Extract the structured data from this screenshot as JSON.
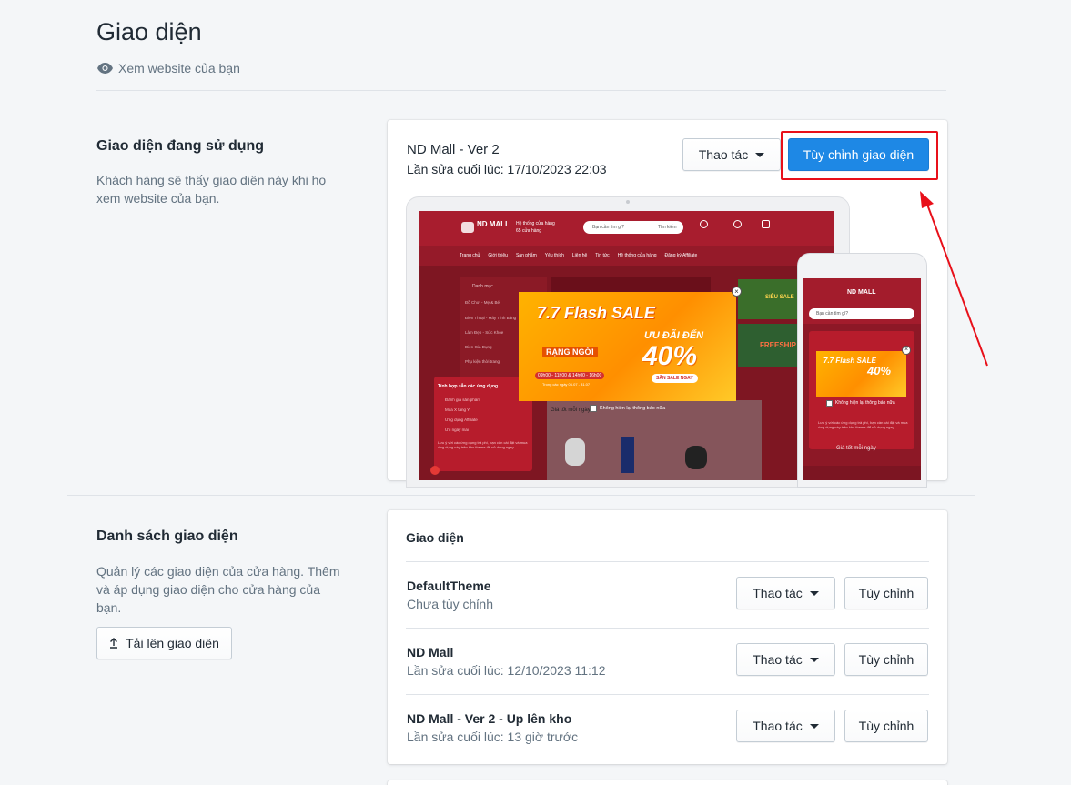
{
  "header": {
    "title": "Giao diện",
    "view_site": "Xem website của bạn"
  },
  "current": {
    "section_title": "Giao diện đang sử dụng",
    "section_desc": "Khách hàng sẽ thấy giao diện này khi họ xem website của bạn.",
    "theme_name": "ND Mall - Ver 2",
    "last_edit": "Lần sửa cuối lúc: 17/10/2023 22:03",
    "actions_label": "Thao tác",
    "customize_label": "Tùy chỉnh giao diện"
  },
  "preview": {
    "logo": "ND MALL",
    "search_placeholder": "Bạn cần tìm gì?",
    "search_btn": "Tìm kiếm",
    "store_text": "Hệ thống cửa hàng",
    "store_sub": "65 cửa hàng",
    "nav": [
      "Trang chủ",
      "Giới thiệu",
      "Sản phẩm",
      "Yêu thích",
      "Liên hệ",
      "Tin tức",
      "Hệ thống cửa hàng",
      "Đăng ký Affiliate"
    ],
    "category_title": "Danh mục",
    "categories": [
      "Đồ Chơi - Mẹ & Bé",
      "Điện Thoại - Máy Tính Bảng",
      "Làm Đẹp - Sức Khỏe",
      "Điện Gia Dụng",
      "Phụ kiện thời trang"
    ],
    "banner_main": "7.7 Flash SALE",
    "banner_sub": "RẠNG NGỜI",
    "banner_time": "09h00 - 11h00 & 14h00 - 16h00",
    "banner_range": "Trong các ngày 06.07 - 31.07",
    "banner_offer": "ƯU ĐÃI ĐẾN",
    "banner_pct": "40%",
    "banner_cta": "SĂN SALE NGAY",
    "dont_show": "Không hiện lại thông báo nữa",
    "best_price": "Giá tốt mỗi ngày",
    "sale_tag": "SIÊU SALE",
    "freeship": "FREESHIP",
    "popup_title": "Tính hợp sẵn các ứng dụng",
    "popup_items": [
      "Đánh giá sản phẩm",
      "Mua X tặng Y",
      "Ứng dụng Affiliate",
      "Ưu ngày mai"
    ],
    "popup_note": "Lưu ý với các ứng dụng trả phí, bạn cần cài đặt và mua ứng dụng này trên kho theme để sử dụng ngay"
  },
  "themes": {
    "section_title": "Danh sách giao diện",
    "section_desc": "Quản lý các giao diện của cửa hàng. Thêm và áp dụng giao diện cho cửa hàng của bạn.",
    "upload_label": "Tải lên giao diện",
    "card_title": "Giao diện",
    "actions_label": "Thao tác",
    "customize_label": "Tùy chỉnh",
    "items": [
      {
        "name": "DefaultTheme",
        "sub": "Chưa tùy chỉnh"
      },
      {
        "name": "ND Mall",
        "sub": "Lần sửa cuối lúc: 12/10/2023 11:12"
      },
      {
        "name": "ND Mall - Ver 2 - Up lên kho",
        "sub": "Lần sửa cuối lúc: 13 giờ trước"
      }
    ]
  },
  "colors": {
    "primary": "#1e88e5",
    "highlight": "#e8101a",
    "brand_red": "#9a1c2a"
  },
  "icons": {
    "view": "eye-icon",
    "upload": "upload-icon",
    "caret": "caret-down-icon",
    "annotation": "red-arrow-icon"
  }
}
